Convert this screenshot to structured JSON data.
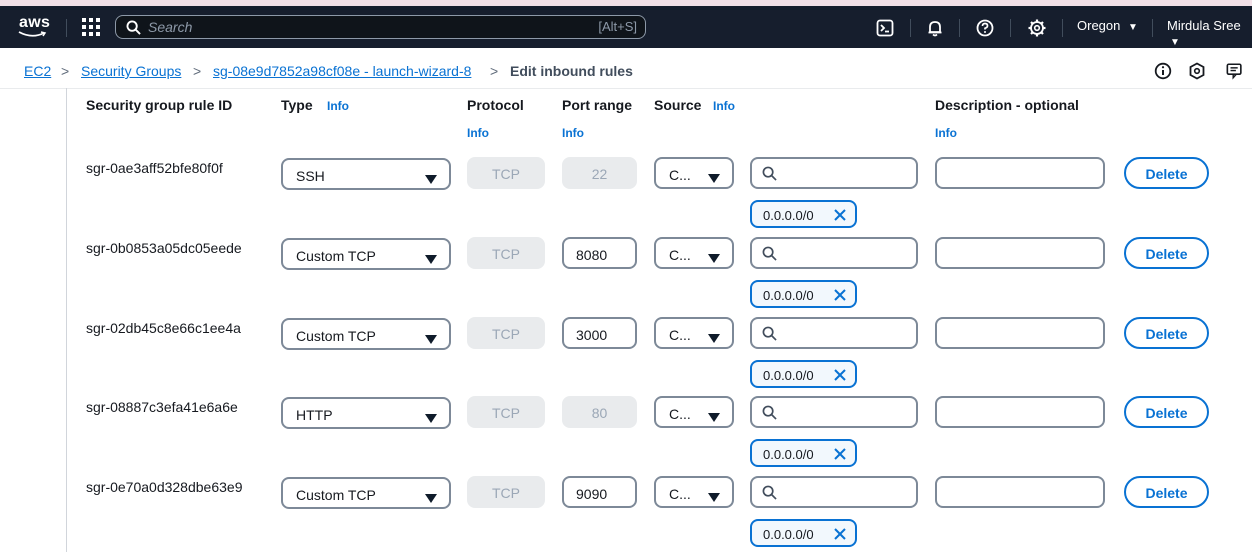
{
  "topbar": {
    "logo_text": "aws",
    "search_placeholder": "Search",
    "search_shortcut": "[Alt+S]",
    "region": "Oregon",
    "user": "Mirdula Sree",
    "icons": [
      "apps-grid-icon",
      "search-icon",
      "cloudshell-icon",
      "bell-icon",
      "help-icon",
      "settings-icon"
    ]
  },
  "breadcrumb": {
    "items": [
      "EC2",
      "Security Groups",
      "sg-08e9d7852a98cf08e - launch-wizard-8"
    ],
    "current": "Edit inbound rules",
    "separator": ">"
  },
  "table": {
    "headers": {
      "rule_id": "Security group rule ID",
      "type": "Type",
      "protocol": "Protocol",
      "port_range": "Port range",
      "source": "Source",
      "description": "Description - optional"
    },
    "info_label": "Info",
    "delete_label": "Delete",
    "rows": [
      {
        "id": "sgr-0ae3aff52bfe80f0f",
        "type": "SSH",
        "protocol": "TCP",
        "port": "22",
        "port_editable": false,
        "source": "C...",
        "cidr": "0.0.0.0/0"
      },
      {
        "id": "sgr-0b0853a05dc05eede",
        "type": "Custom TCP",
        "protocol": "TCP",
        "port": "8080",
        "port_editable": true,
        "source": "C...",
        "cidr": "0.0.0.0/0"
      },
      {
        "id": "sgr-02db45c8e66c1ee4a",
        "type": "Custom TCP",
        "protocol": "TCP",
        "port": "3000",
        "port_editable": true,
        "source": "C...",
        "cidr": "0.0.0.0/0"
      },
      {
        "id": "sgr-08887c3efa41e6a6e",
        "type": "HTTP",
        "protocol": "TCP",
        "port": "80",
        "port_editable": false,
        "source": "C...",
        "cidr": "0.0.0.0/0"
      },
      {
        "id": "sgr-0e70a0d328dbe63e9",
        "type": "Custom TCP",
        "protocol": "TCP",
        "port": "9090",
        "port_editable": true,
        "source": "C...",
        "cidr": "0.0.0.0/0"
      }
    ]
  },
  "colors": {
    "nav_bg": "#161e2d",
    "link": "#0972d3",
    "disabled_bg": "#e9ebed",
    "border": "#7d8998"
  }
}
